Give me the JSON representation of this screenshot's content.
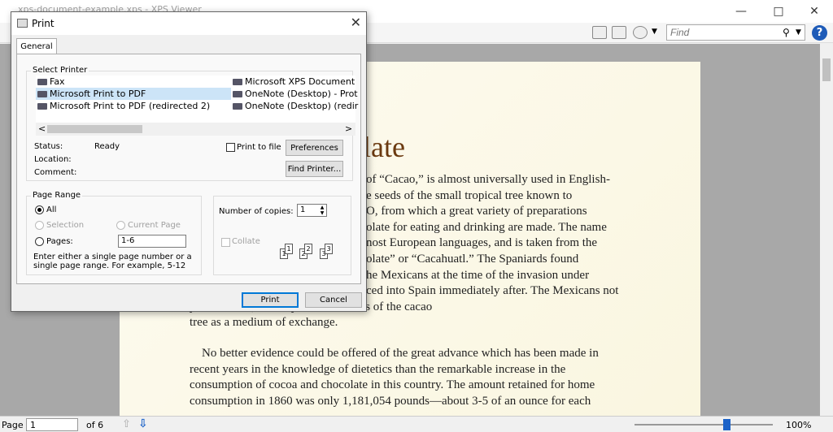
{
  "window": {
    "title": "xps-document-example.xps - XPS Viewer"
  },
  "toolbar": {
    "find_placeholder": "Find",
    "help_label": "?"
  },
  "document": {
    "heading": "olate",
    "lines": [
      "of “Cacao,” is almost universally used in English-",
      "e seeds of the small tropical tree known to",
      "O, from which a great variety of preparations",
      "olate for eating and drinking are made. The name",
      "nost European languages, and is taken from the",
      "olate” or “Cacahuatl.” The Spaniards found",
      "he Mexicans at the time of the invasion under",
      "ced into Spain immediately after. The Mexicans not",
      "y                                            cle of food, but they used the seeds of the cacao",
      "tree as a medium of exchange."
    ],
    "para2": [
      "    No better evidence could be offered of the great advance which has been made in",
      "recent years in the knowledge of dietetics than the remarkable increase in the",
      "consumption of cocoa and chocolate in this country. The amount retained for home",
      "consumption in 1860 was only 1,181,054 pounds—about 3-5 of an ounce for each"
    ]
  },
  "statusbar": {
    "page_label": "Page",
    "page_value": "1",
    "of_label": "of 6",
    "zoom": "100%"
  },
  "dialog": {
    "title": "Print",
    "tab": "General",
    "select_printer_label": "Select Printer",
    "printers_left": [
      "Fax",
      "Microsoft Print to PDF",
      "Microsoft Print to PDF (redirected 2)"
    ],
    "printers_right": [
      "Microsoft XPS Document",
      "OneNote (Desktop) - Prot",
      "OneNote (Desktop) (redir"
    ],
    "status_label": "Status:",
    "status_value": "Ready",
    "location_label": "Location:",
    "comment_label": "Comment:",
    "print_to_file": "Print to file",
    "preferences": "Preferences",
    "find_printer": "Find Printer...",
    "page_range_label": "Page Range",
    "all": "All",
    "selection": "Selection",
    "current_page": "Current Page",
    "pages": "Pages:",
    "pages_value": "1-6",
    "hint": "Enter either a single page number or a single page range.  For example, 5-12",
    "copies_label": "Number of copies:",
    "copies_value": "1",
    "collate": "Collate",
    "print_btn": "Print",
    "cancel_btn": "Cancel"
  }
}
